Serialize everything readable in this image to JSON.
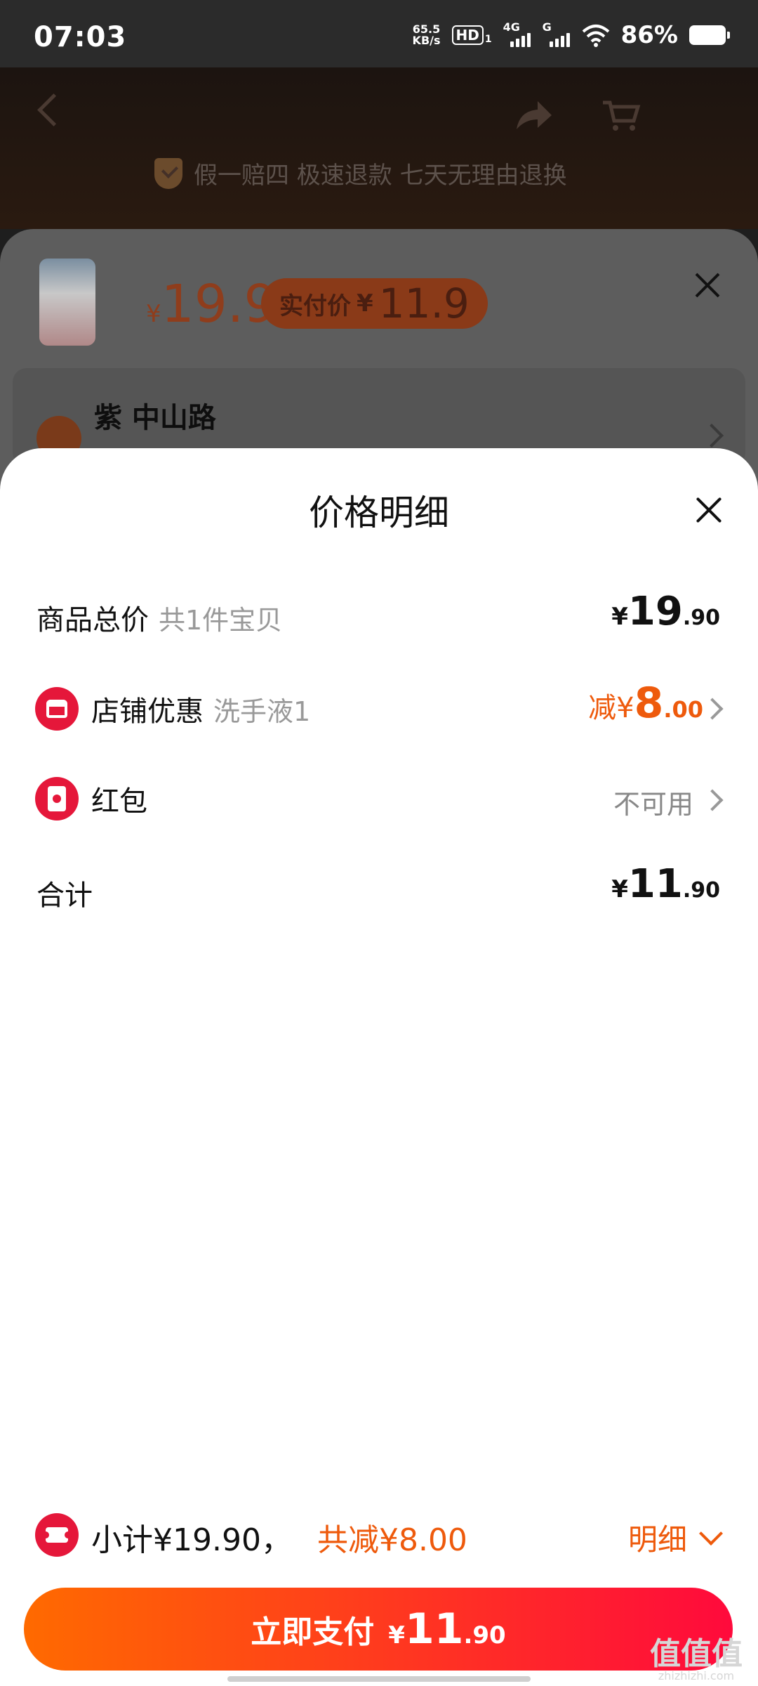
{
  "status_bar": {
    "time": "07:03",
    "net_speed_value": "65.5",
    "net_speed_unit": "KB/s",
    "hd": "HD",
    "hd_sub": "1",
    "net_4g": "4G",
    "net_g": "G",
    "battery": "86%"
  },
  "background_page": {
    "guarantee_text": "假一赔四 极速退款 七天无理由退换",
    "product_price_symbol": "¥",
    "product_price": "19.9",
    "real_price_label": "实付价",
    "real_price_symbol": "¥",
    "real_price": "11.9",
    "address": "紫 中山路"
  },
  "sheet": {
    "title": "价格明细",
    "rows": {
      "goods_total": {
        "label": "商品总价",
        "sub": "共1件宝贝",
        "yen": "¥",
        "int": "19",
        "dec": ".90"
      },
      "store_discount": {
        "label": "店铺优惠",
        "sub": "洗手液1",
        "prefix": "减¥",
        "int": "8",
        "dec": ".00"
      },
      "red_packet": {
        "label": "红包",
        "status": "不可用"
      },
      "total": {
        "label": "合计",
        "yen": "¥",
        "int": "11",
        "dec": ".90"
      }
    }
  },
  "bottom_bar": {
    "subtotal": "小计¥19.90，",
    "total_reduce": "共减¥8.00",
    "detail_label": "明细",
    "pay_label": "立即支付",
    "pay_yen": "¥",
    "pay_int": "11",
    "pay_dec": ".90"
  },
  "watermark": {
    "main": "值值值",
    "sub": "zhizhizhi.com"
  },
  "colors": {
    "accent_orange": "#ee5a0c",
    "brand_red": "#e5173a",
    "pay_gradient_start": "#ff6a00",
    "pay_gradient_end": "#ff0a3c"
  }
}
